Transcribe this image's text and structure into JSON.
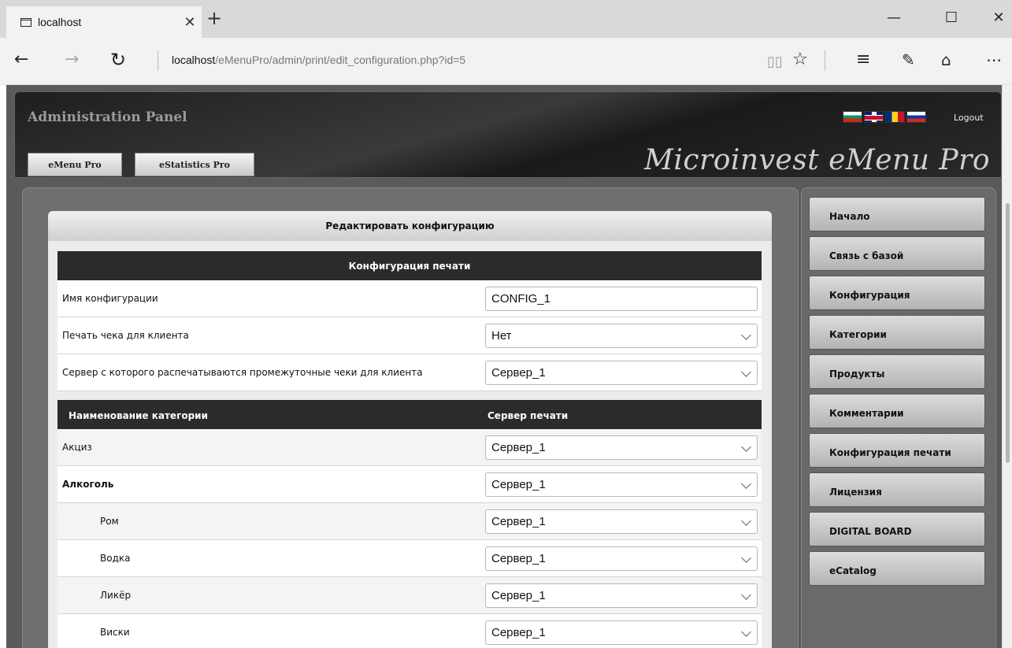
{
  "browser": {
    "tab_title": "localhost",
    "url_host": "localhost",
    "url_path": "/eMenuPro/admin/print/edit_configuration.php?id=5"
  },
  "header": {
    "admin_title": "Administration Panel",
    "btn_emenu": "eMenu Pro",
    "btn_estat": "eStatistics Pro",
    "brand": "Microinvest  eMenu Pro",
    "logout": "Logout",
    "flags": [
      "bulgarian-flag",
      "uk-flag",
      "romanian-flag",
      "russian-flag"
    ]
  },
  "card": {
    "title": "Редактировать конфигурацию",
    "section1_title": "Конфигурация печати",
    "fields": [
      {
        "label": "Имя конфигурации",
        "value": "CONFIG_1"
      },
      {
        "label": "Печать чека для клиента",
        "value": "Нет"
      },
      {
        "label": "Сервер с которого распечатываются промежуточные чеки для клиента",
        "value": "Сервер_1"
      }
    ],
    "section2_col1": "Наименование категории",
    "section2_col2": "Сервер печати",
    "categories": [
      {
        "name": "Акциз",
        "server": "Сервер_1"
      },
      {
        "name": "Алкоголь",
        "server": "Сервер_1"
      },
      {
        "name": "Ром",
        "server": "Сервер_1"
      },
      {
        "name": "Водка",
        "server": "Сервер_1"
      },
      {
        "name": "Ликёр",
        "server": "Сервер_1"
      },
      {
        "name": "Виски",
        "server": "Сервер_1"
      }
    ]
  },
  "menu": [
    "Начало",
    "Связь с базой",
    "Конфигурация",
    "Категории",
    "Продукты",
    "Комментарии",
    "Конфигурация печати",
    "Лицензия",
    "DIGITAL BOARD",
    "eCatalog"
  ]
}
